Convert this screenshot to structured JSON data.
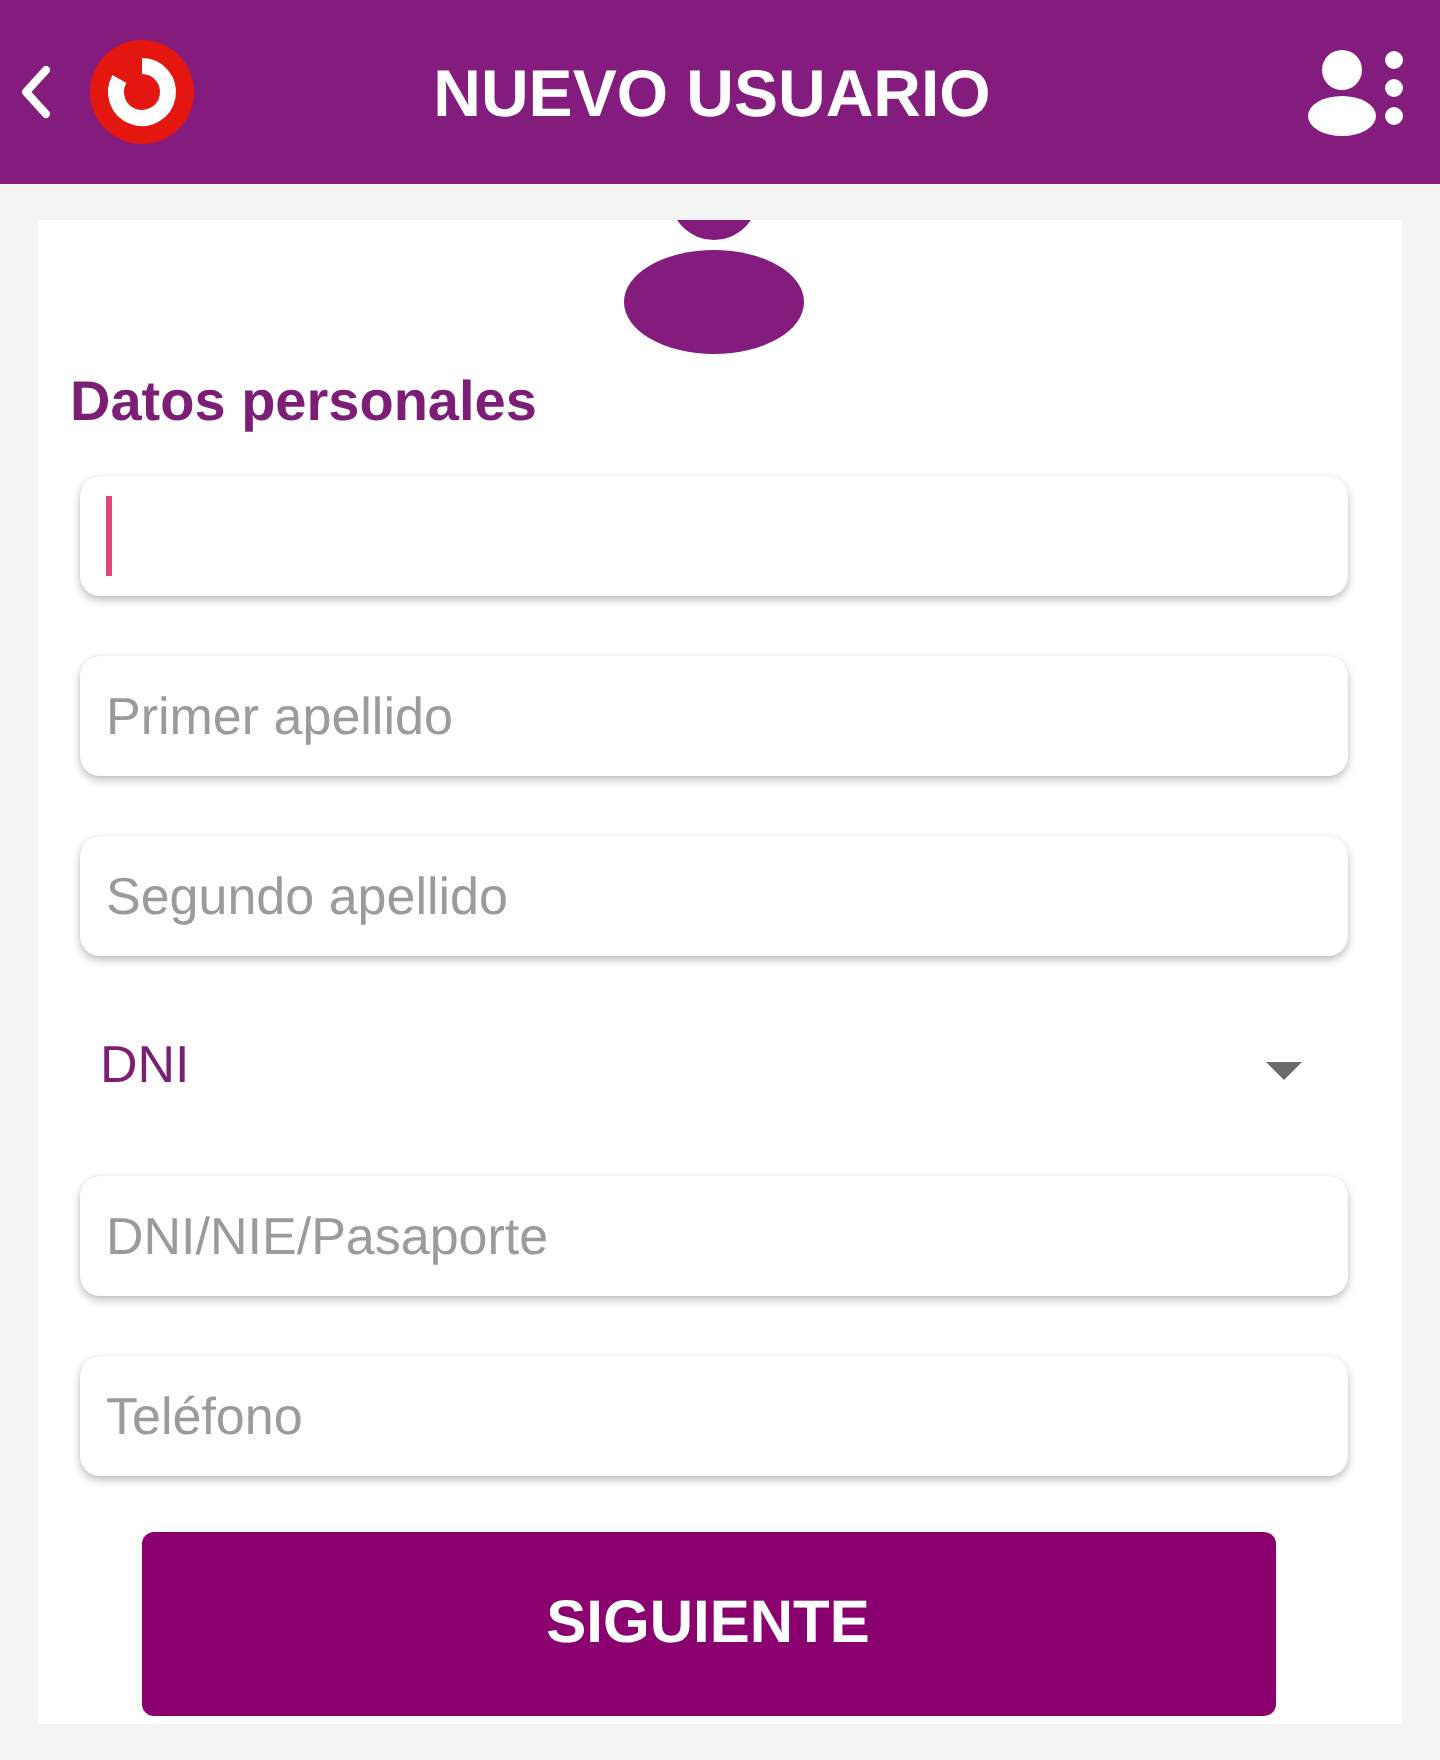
{
  "header": {
    "title": "NUEVO USUARIO"
  },
  "section": {
    "title": "Datos personales"
  },
  "fields": [
    {
      "kind": "input",
      "focused": true
    },
    {
      "kind": "input",
      "placeholder": "Primer apellido",
      "focused": false
    },
    {
      "kind": "input",
      "placeholder": "Segundo apellido",
      "focused": false
    },
    {
      "kind": "select",
      "value": "DNI"
    },
    {
      "kind": "input",
      "placeholder": "DNI/NIE/Pasaporte",
      "focused": false
    },
    {
      "kind": "input",
      "placeholder": "Teléfono",
      "focused": false
    }
  ],
  "primary_button": {
    "label": "SIGUIENTE"
  }
}
